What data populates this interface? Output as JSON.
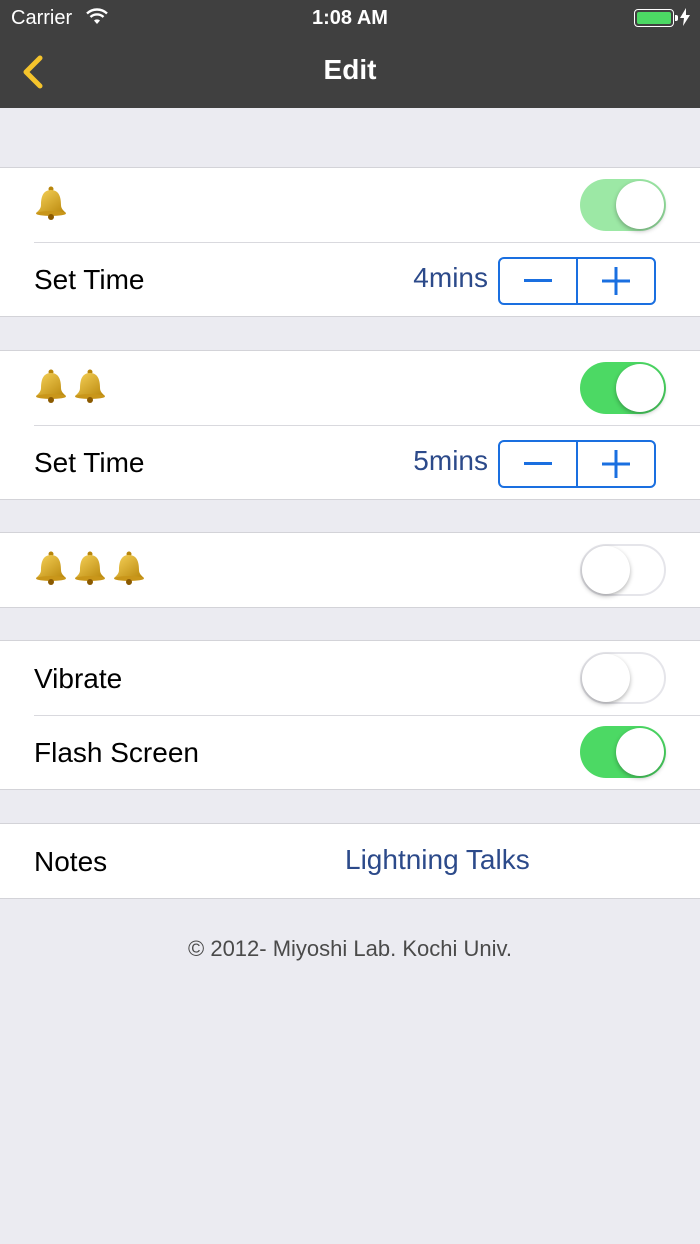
{
  "status_bar": {
    "carrier": "Carrier",
    "time": "1:08 AM"
  },
  "nav": {
    "title": "Edit",
    "back_icon": "chevron-left-icon"
  },
  "alarms": [
    {
      "bells": 1,
      "enabled": true,
      "set_time_label": "Set Time",
      "value": "4mins"
    },
    {
      "bells": 2,
      "enabled": true,
      "set_time_label": "Set Time",
      "value": "5mins"
    },
    {
      "bells": 3,
      "enabled": false
    }
  ],
  "options": {
    "vibrate_label": "Vibrate",
    "vibrate": false,
    "flash_label": "Flash Screen",
    "flash": true
  },
  "notes": {
    "label": "Notes",
    "value": "Lightning Talks"
  },
  "footer": "© 2012- Miyoshi Lab. Kochi Univ.",
  "colors": {
    "nav_bg": "#404040",
    "accent_back": "#f5c42c",
    "switch_on": "#4cd964",
    "stepper": "#1a6fe0",
    "value_text": "#2c4a8a",
    "background": "#ebebf1"
  }
}
